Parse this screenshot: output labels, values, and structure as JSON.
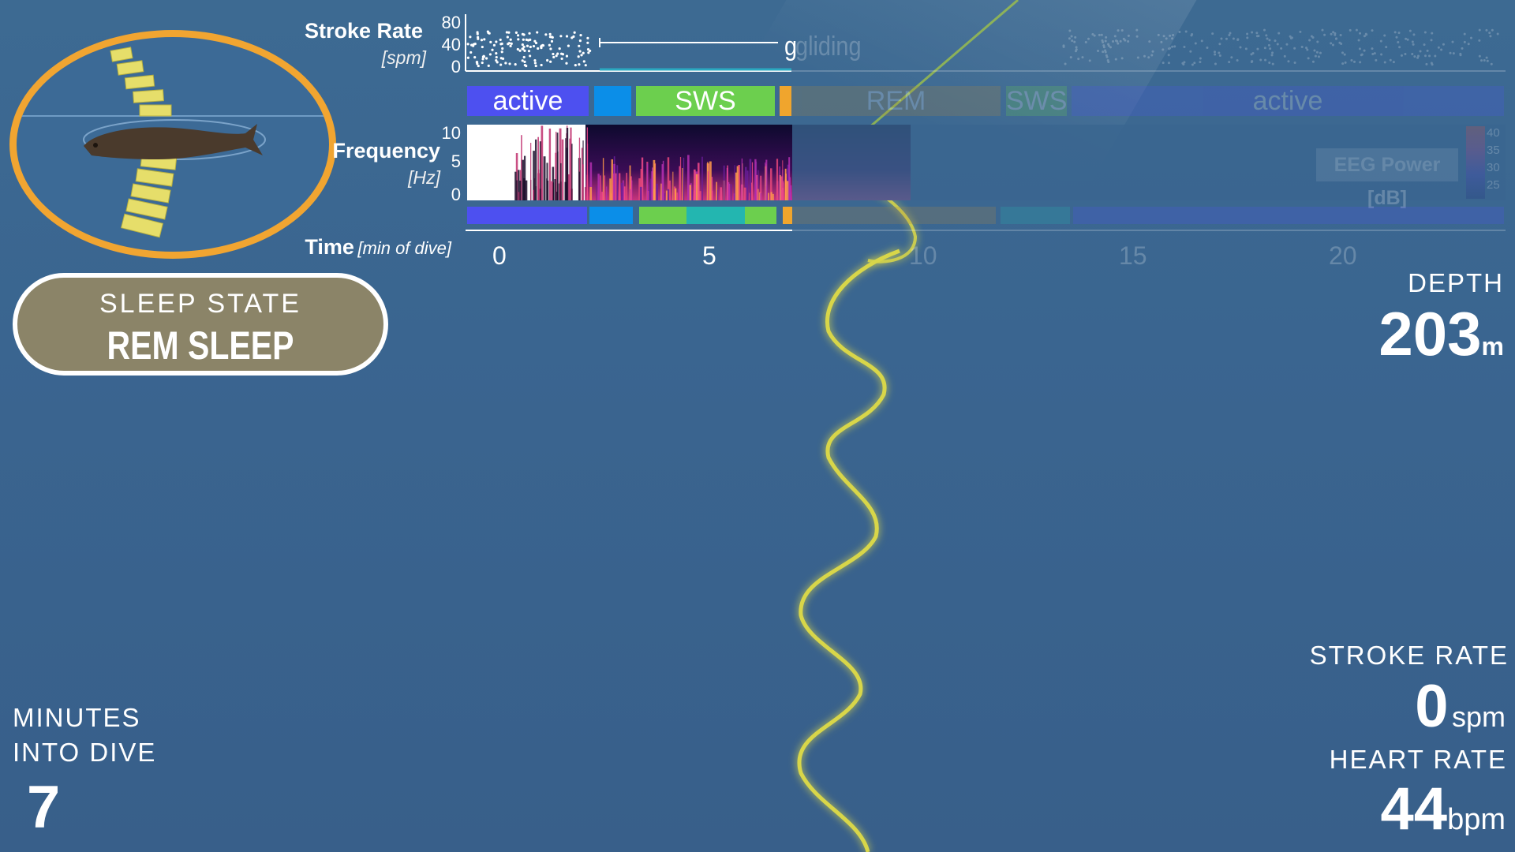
{
  "stroke_plot": {
    "label": "Stroke Rate",
    "unit": "[spm]",
    "ticks": [
      "80",
      "40",
      "0"
    ],
    "mode_label": "gliding"
  },
  "stage_bar": {
    "active_label": "active",
    "sws_label": "SWS",
    "rem_label": "REM",
    "sws2_label": "SWS",
    "active2_label": "active"
  },
  "freq_plot": {
    "label": "Frequency",
    "unit": "[Hz]",
    "ticks": [
      "10",
      "5",
      "0"
    ],
    "power_label": "EEG Power [dB]",
    "power_ticks": [
      "40",
      "35",
      "30",
      "25"
    ]
  },
  "time_axis": {
    "label": "Time",
    "unit": "[min of dive]",
    "ticks": [
      "0",
      "5",
      "10",
      "15",
      "20"
    ]
  },
  "sleep_state": {
    "heading": "SLEEP STATE",
    "value": "REM SLEEP"
  },
  "depth": {
    "label": "DEPTH",
    "value": "203",
    "unit": "m"
  },
  "stroke": {
    "label": "STROKE RATE",
    "value": "0",
    "unit": "spm"
  },
  "heart": {
    "label": "HEART RATE",
    "value": "44",
    "unit": "bpm"
  },
  "minutes": {
    "label_line1": "MINUTES",
    "label_line2": "INTO DIVE",
    "value": "7"
  },
  "colors": {
    "active": "#4d50f0",
    "transition": "#0b8ee8",
    "sws": "#6ccf4e",
    "rem": "#f0a52d",
    "background": "#3a6590",
    "path": "#d8d64a"
  }
}
